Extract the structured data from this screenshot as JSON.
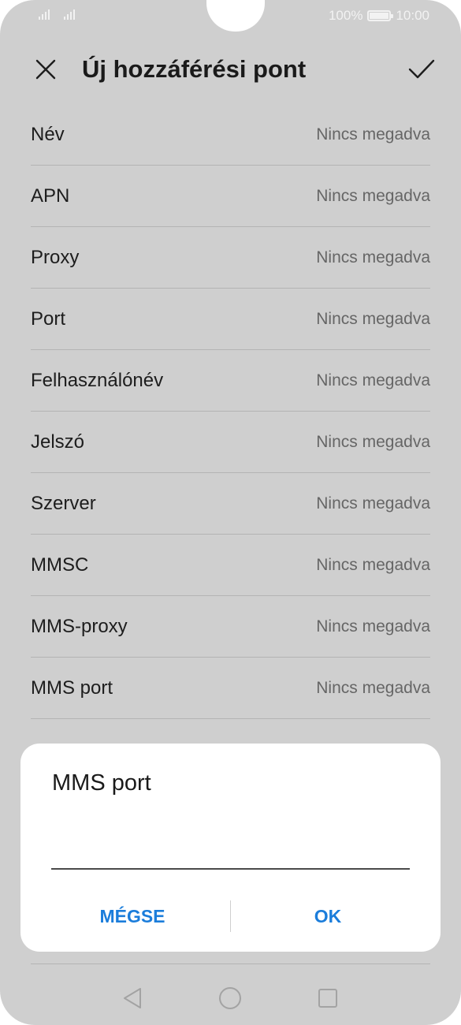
{
  "status_bar": {
    "battery_percent": "100%",
    "time": "10:00"
  },
  "header": {
    "title": "Új hozzáférési pont",
    "close_icon": "close-icon",
    "confirm_icon": "check-icon"
  },
  "fields": [
    {
      "label": "Név",
      "value": "Nincs megadva"
    },
    {
      "label": "APN",
      "value": "Nincs megadva"
    },
    {
      "label": "Proxy",
      "value": "Nincs megadva"
    },
    {
      "label": "Port",
      "value": "Nincs megadva"
    },
    {
      "label": "Felhasználónév",
      "value": "Nincs megadva"
    },
    {
      "label": "Jelszó",
      "value": "Nincs megadva"
    },
    {
      "label": "Szerver",
      "value": "Nincs megadva"
    },
    {
      "label": "MMSC",
      "value": "Nincs megadva"
    },
    {
      "label": "MMS-proxy",
      "value": "Nincs megadva"
    },
    {
      "label": "MMS port",
      "value": "Nincs megadva"
    }
  ],
  "dialog": {
    "title": "MMS port",
    "input_value": "",
    "cancel_label": "MÉGSE",
    "ok_label": "OK"
  },
  "colors": {
    "accent": "#1b7ddb",
    "overlay_background": "#cfcfcf",
    "dialog_background": "#ffffff"
  },
  "nav": {
    "back_icon": "back-triangle-icon",
    "home_icon": "home-circle-icon",
    "recent_icon": "recent-square-icon"
  }
}
